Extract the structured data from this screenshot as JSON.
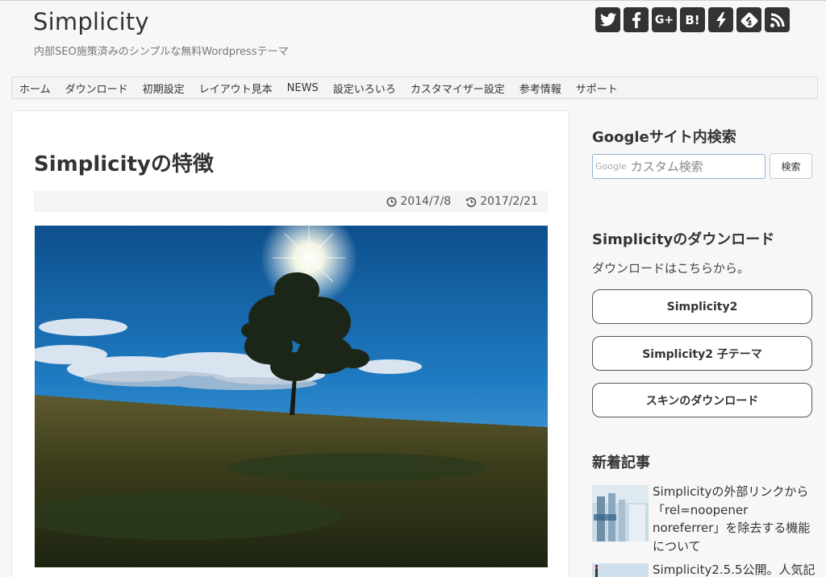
{
  "header": {
    "site_title": "Simplicity",
    "site_description": "内部SEO施策済みのシンプルな無料Wordpressテーマ",
    "sns_icons": [
      "twitter-icon",
      "facebook-icon",
      "google-plus-icon",
      "hatena-bookmark-icon",
      "bolt-icon",
      "feedly-icon",
      "rss-icon"
    ],
    "google_plus_label": "G+",
    "hatena_label": "B!"
  },
  "nav": {
    "items": [
      "ホーム",
      "ダウンロード",
      "初期設定",
      "レイアウト見本",
      "NEWS",
      "設定いろいろ",
      "カスタマイザー設定",
      "参考情報",
      "サポート"
    ]
  },
  "article": {
    "title": "Simplicityの特徴",
    "published_date": "2014/7/8",
    "updated_date": "2017/2/21"
  },
  "sidebar": {
    "search": {
      "title": "Googleサイト内検索",
      "google_mark": "Google",
      "placeholder": "カスタム検索",
      "button_label": "検索"
    },
    "download": {
      "title": "Simplicityのダウンロード",
      "text": "ダウンロードはこちらから。",
      "buttons": [
        "Simplicity2",
        "Simplicity2 子テーマ",
        "スキンのダウンロード"
      ]
    },
    "recent": {
      "title": "新着記事",
      "posts": [
        {
          "lines": [
            "Simplicityの外部リンクから",
            "「rel=noopener",
            "noreferrer」を除去する機能",
            "について"
          ]
        },
        {
          "lines": [
            "Simplicity2.5.5公開。人気記"
          ]
        }
      ]
    }
  },
  "colors": {
    "background": "#f7f7f7",
    "sns_button": "#333333",
    "search_border": "#8fb3d8"
  }
}
